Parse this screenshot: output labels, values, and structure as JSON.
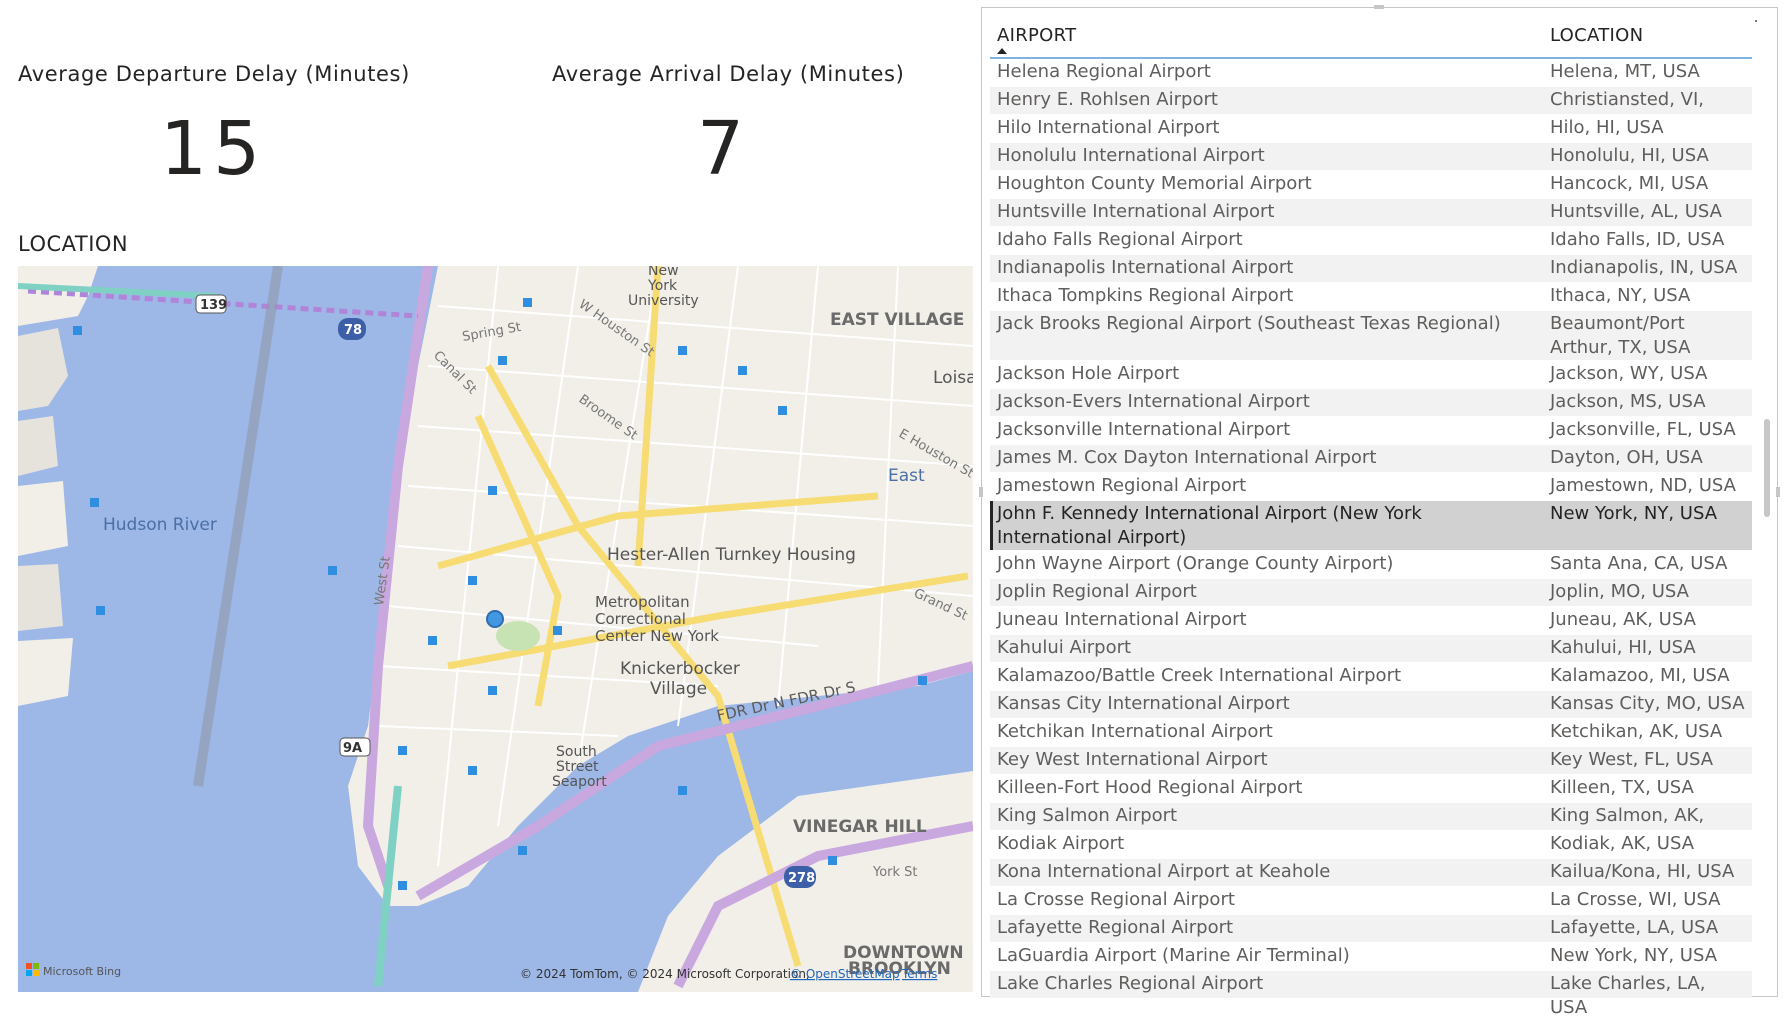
{
  "cards": [
    {
      "title": "Average Departure Delay (Minutes)",
      "value": "15"
    },
    {
      "title": "Average Arrival Delay (Minutes)",
      "value": "7"
    }
  ],
  "map": {
    "title": "LOCATION",
    "attribution": "© 2024 TomTom, © 2024 Microsoft Corporation,",
    "osm_link": "© OpenStreetMap",
    "terms_link": "Terms",
    "logo": "Microsoft Bing",
    "labels": {
      "east_village": "EAST VILLAGE",
      "loisa": "Loisa",
      "nyu1": "New",
      "nyu2": "York",
      "nyu3": "University",
      "hudson": "Hudson River",
      "hester": "Hester-Allen Turnkey Housing",
      "metro1": "Metropolitan",
      "metro2": "Correctional",
      "metro3": "Center New York",
      "knick1": "Knickerbocker",
      "knick2": "Village",
      "fdr": "FDR Dr N FDR Dr S",
      "east": "East",
      "south1": "South",
      "south2": "Street",
      "south3": "Seaport",
      "vinegar": "VINEGAR HILL",
      "downtown1": "DOWNTOWN",
      "downtown2": "BROOKLYN",
      "west_st": "West St",
      "canal": "Canal St",
      "spring": "Spring St",
      "broome": "Broome St",
      "houston": "W Houston St",
      "ehouston": "E Houston St",
      "grand": "Grand St",
      "york": "York St",
      "shield_139": "139",
      "shield_78": "78",
      "shield_9a": "9A",
      "shield_278": "278"
    }
  },
  "table": {
    "columns": [
      "AIRPORT",
      "LOCATION"
    ],
    "sort_column": "AIRPORT",
    "rows": [
      {
        "airport": "Helena Regional Airport",
        "location": "Helena, MT, USA"
      },
      {
        "airport": "Henry E. Rohlsen Airport",
        "location": "Christiansted, VI, USA"
      },
      {
        "airport": "Hilo International Airport",
        "location": "Hilo, HI, USA"
      },
      {
        "airport": "Honolulu International Airport",
        "location": "Honolulu, HI, USA"
      },
      {
        "airport": "Houghton County Memorial Airport",
        "location": "Hancock, MI, USA"
      },
      {
        "airport": "Huntsville International Airport",
        "location": "Huntsville, AL, USA"
      },
      {
        "airport": "Idaho Falls Regional Airport",
        "location": "Idaho Falls, ID, USA"
      },
      {
        "airport": "Indianapolis International Airport",
        "location": "Indianapolis, IN, USA"
      },
      {
        "airport": "Ithaca Tompkins Regional Airport",
        "location": "Ithaca, NY, USA"
      },
      {
        "airport": "Jack Brooks Regional Airport (Southeast Texas Regional)",
        "location": "Beaumont/Port Arthur, TX, USA"
      },
      {
        "airport": "Jackson Hole Airport",
        "location": "Jackson, WY, USA"
      },
      {
        "airport": "Jackson-Evers International Airport",
        "location": "Jackson, MS, USA"
      },
      {
        "airport": "Jacksonville International Airport",
        "location": "Jacksonville, FL, USA"
      },
      {
        "airport": "James M. Cox Dayton International Airport",
        "location": "Dayton, OH, USA"
      },
      {
        "airport": "Jamestown Regional Airport",
        "location": "Jamestown, ND, USA"
      },
      {
        "airport": "John F. Kennedy International Airport (New York International Airport)",
        "location": "New York, NY, USA",
        "selected": true
      },
      {
        "airport": "John Wayne Airport (Orange County Airport)",
        "location": "Santa Ana, CA, USA"
      },
      {
        "airport": "Joplin Regional Airport",
        "location": "Joplin, MO, USA"
      },
      {
        "airport": "Juneau International Airport",
        "location": "Juneau, AK, USA"
      },
      {
        "airport": "Kahului Airport",
        "location": "Kahului, HI, USA"
      },
      {
        "airport": "Kalamazoo/Battle Creek International Airport",
        "location": "Kalamazoo, MI, USA"
      },
      {
        "airport": "Kansas City International Airport",
        "location": "Kansas City, MO, USA"
      },
      {
        "airport": "Ketchikan International Airport",
        "location": "Ketchikan, AK, USA"
      },
      {
        "airport": "Key West International Airport",
        "location": "Key West, FL, USA"
      },
      {
        "airport": "Killeen-Fort Hood Regional Airport",
        "location": "Killeen, TX, USA"
      },
      {
        "airport": "King Salmon Airport",
        "location": "King Salmon, AK, USA"
      },
      {
        "airport": "Kodiak Airport",
        "location": "Kodiak, AK, USA"
      },
      {
        "airport": "Kona International Airport at Keahole",
        "location": "Kailua/Kona, HI, USA"
      },
      {
        "airport": "La Crosse Regional Airport",
        "location": "La Crosse, WI, USA"
      },
      {
        "airport": "Lafayette Regional Airport",
        "location": "Lafayette, LA, USA"
      },
      {
        "airport": "LaGuardia Airport (Marine Air Terminal)",
        "location": "New York, NY, USA"
      },
      {
        "airport": "Lake Charles Regional Airport",
        "location": "Lake Charles, LA, USA"
      }
    ],
    "toolbar": {
      "filter_icon": "filter-icon",
      "focus_icon": "focus-mode-icon",
      "more_icon": "more-options-icon"
    }
  },
  "colors": {
    "water": "#9db7e6",
    "land": "#f2efe9",
    "highway": "#c9a8e0",
    "arterial": "#f7dc74",
    "header_underline": "#7fb2e5",
    "selected_row": "#d1d1d1"
  }
}
